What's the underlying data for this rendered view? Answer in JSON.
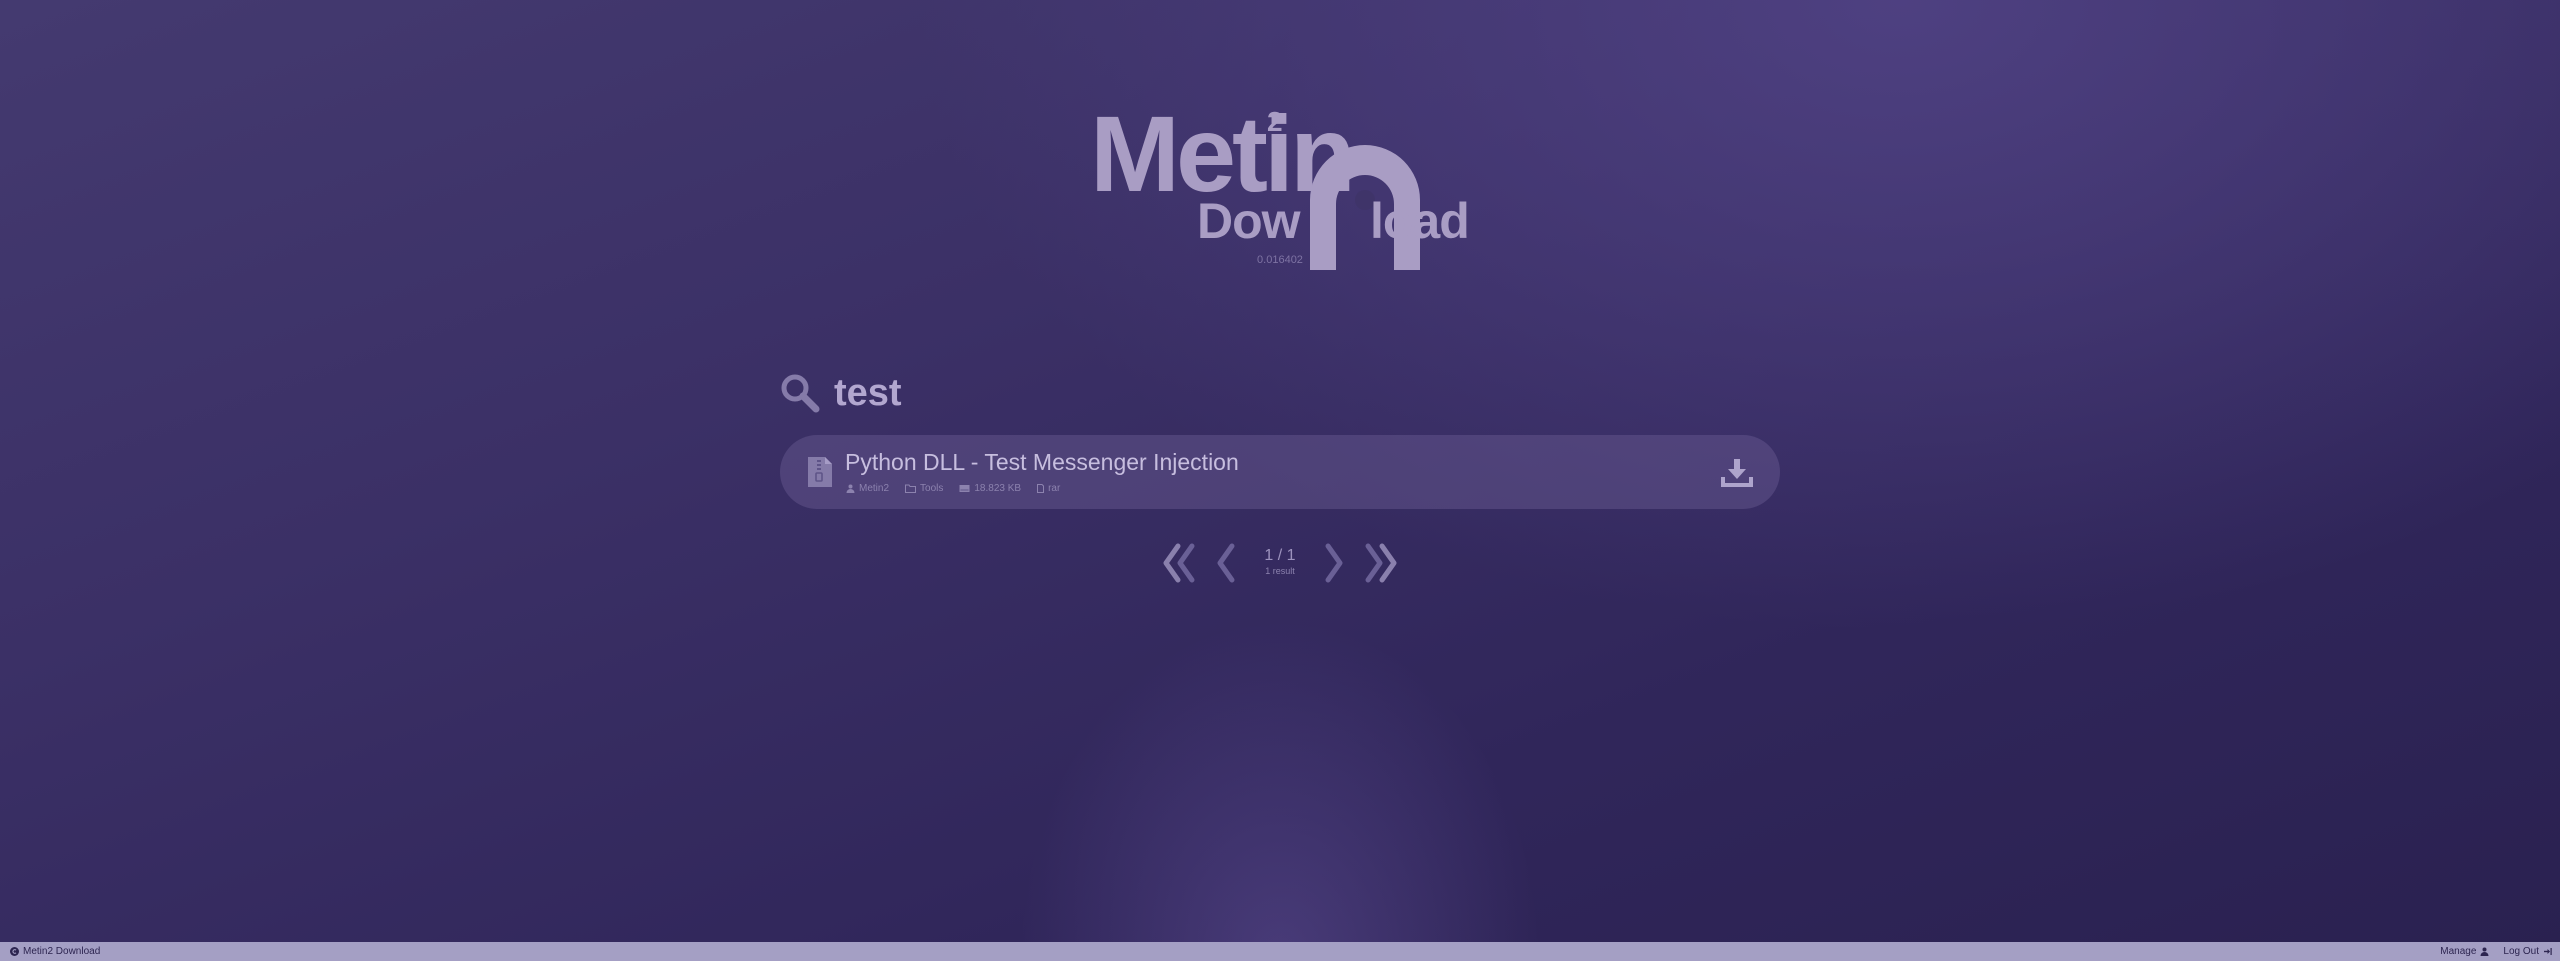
{
  "logo": {
    "metin": "Metin",
    "superscript": "2",
    "dow": "Dow",
    "load": "load"
  },
  "version": "0.016402",
  "search": {
    "query": "test",
    "icon": "search-icon"
  },
  "results": [
    {
      "title": "Python DLL - Test Messenger Injection",
      "author": "Metin2",
      "category": "Tools",
      "size": "18.823 KB",
      "format": "rar",
      "icons": {
        "file": "file-archive-icon",
        "author": "user-icon",
        "category": "folder-icon",
        "size": "drive-icon",
        "format": "file-icon",
        "download": "download-icon"
      }
    }
  ],
  "pagination": {
    "label": "1 / 1",
    "count": "1 result"
  },
  "footer": {
    "brand": "Metin2 Download",
    "manage": "Manage",
    "logout": "Log Out"
  },
  "colors": {
    "background": "#3b3066",
    "accent": "#a99dc4",
    "footer": "#a49fc4"
  }
}
